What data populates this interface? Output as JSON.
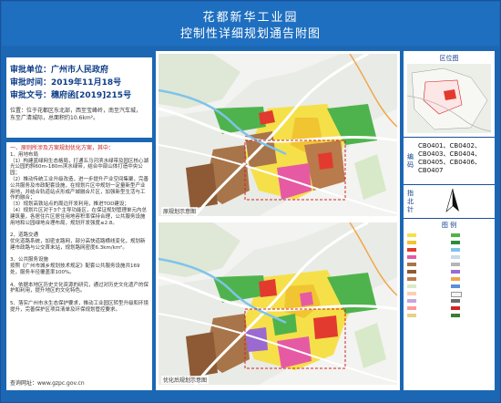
{
  "header": {
    "title": "花都新华工业园",
    "subtitle": "控制性详细规划通告附图"
  },
  "info": {
    "approval_unit": "审批单位：广州市人民政府",
    "approval_date": "审批时间：2019年11月18号",
    "approval_doc": "审批文号：穗府函[2019]215号",
    "location_head": "位置：",
    "location_text": "位于花都区东北部，西至宝峰岭，南至汽车城，东至广清城际，总面积约10.6km²。"
  },
  "description": {
    "head": "一、原则所涉及方案规划优化方案，其中：",
    "body": "1、用地布局\n（1）构建蓝绿网生态格局，打通五马河滨水绿带及园区核心湖光公园的斜60m-180m滨水绿带，结合中部山体打造中央公园；\n（2）推动传统工业升级改造，进一步提升产业空间集聚，完善公共服务及市政配套设施，在规划片区中规划一定量新型产业用地，并结合轨道站点形成产城融合片区，加强新型生活与工作的融合；\n（3）规划高铁站点的周边开发利用，推进TOD建设；\n（4）规划片区对于3个主导功能区，在保证规划管理单元内总建筑量，各居住片区居住用地容积率保持合理，公共服务设施用地和公园绿地合理布局，规划开发强度≤2.8。\n\n2、道路交通\n优化道路系统，加密支路网，部分高快道路横线变化，规划新建市政路与公交首末站，规划路网密度6.3km/km²。\n\n3、公共服务设施\n按照《广州市城乡规划技术规定》配套公共服务设施共169处，服务半径覆盖率100%。\n\n4、依据本地区历史文化资源的研究，通过对历史文化遗产的保护和利用，提升地区的文化特色。\n\n5、落实广州市水生态保护要求，推动工业园区转型升级和环境提升，完善保护区项目清单及环保规划管控要求。",
    "url": "查询网址：www.gzpc.gov.cn"
  },
  "maps": {
    "top_label": "原规划示意图",
    "bottom_label": "优化后规划示意图"
  },
  "right": {
    "location_title": "区位图",
    "code_title": "编 码",
    "codes": "CB0401、CB0402、CB0403、CB0404、CB0405、CB0406、CB0407",
    "north_title": "指北针",
    "legend_title": "图 例"
  },
  "colors": {
    "frame": "#1c67b4",
    "header": "#1f6fc0",
    "residential": "#f5e04a",
    "industrial": "#a8754a",
    "commercial": "#e23a2e",
    "public": "#e65aa4",
    "green": "#4fb34d",
    "water": "#7fc3ea",
    "road": "#ffffff"
  }
}
